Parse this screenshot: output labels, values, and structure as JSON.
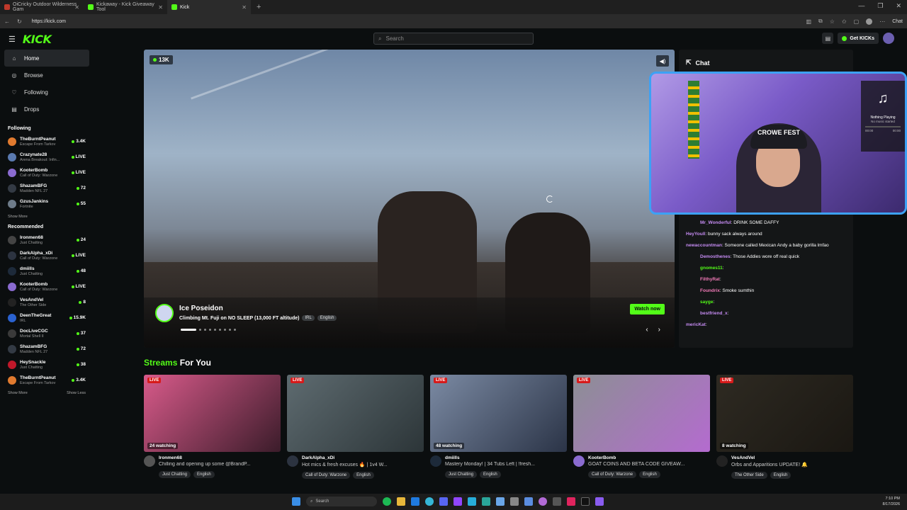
{
  "browser": {
    "tabs": [
      {
        "label": "OiCricky Outdoor Wilderness Gam",
        "color": "#c0392b"
      },
      {
        "label": "Kickaway - Kick Giveaway Tool",
        "color": "#53fc18"
      },
      {
        "label": "Kick",
        "color": "#53fc18"
      }
    ],
    "url": "https://kick.com",
    "chat_label": "Chat"
  },
  "header": {
    "logo": "KICK",
    "search_placeholder": "Search",
    "get_kicks": "Get KICKs"
  },
  "sidebar": {
    "nav": [
      {
        "label": "Home",
        "icon": "home-icon",
        "glyph": "⌂"
      },
      {
        "label": "Browse",
        "icon": "compass-icon",
        "glyph": "◎"
      },
      {
        "label": "Following",
        "icon": "heart-icon",
        "glyph": "♡"
      },
      {
        "label": "Drops",
        "icon": "drops-icon",
        "glyph": "▤"
      }
    ],
    "following_title": "Following",
    "following": [
      {
        "name": "TheBurntPeanut",
        "cat": "Escape From Tarkov",
        "count": "3.4K",
        "color": "#e07a2f"
      },
      {
        "name": "Crazynate28",
        "cat": "Arena Breakout: Infin...",
        "count": "LIVE",
        "color": "#5a7ab0"
      },
      {
        "name": "KooterBomb",
        "cat": "Call of Duty: Warzone",
        "count": "LIVE",
        "color": "#8a6bd0"
      },
      {
        "name": "ShazamBFG",
        "cat": "Madden NFL 27",
        "count": "72",
        "color": "#333a44"
      },
      {
        "name": "GzusJankins",
        "cat": "Fortnite",
        "count": "55",
        "color": "#6e7c8a"
      }
    ],
    "show_more": "Show More",
    "recommended_title": "Recommended",
    "recommended": [
      {
        "name": "Ironmen68",
        "cat": "Just Chatting",
        "count": "24",
        "color": "#444"
      },
      {
        "name": "DarkAlpha_xDi",
        "cat": "Call of Duty: Warzone",
        "count": "LIVE",
        "color": "#2c3340"
      },
      {
        "name": "dmiills",
        "cat": "Just Chatting",
        "count": "48",
        "color": "#1d2a3a"
      },
      {
        "name": "KooterBomb",
        "cat": "Call of Duty: Warzone",
        "count": "LIVE",
        "color": "#8a6bd0"
      },
      {
        "name": "VesAndVel",
        "cat": "The Other Side",
        "count": "8",
        "color": "#222"
      },
      {
        "name": "DeenTheGreat",
        "cat": "IRL",
        "count": "15.9K",
        "color": "#2a62d0"
      },
      {
        "name": "DocLiveCGC",
        "cat": "Mortal Shell II",
        "count": "37",
        "color": "#3a3a3a"
      },
      {
        "name": "ShazamBFG",
        "cat": "Madden NFL 27",
        "count": "72",
        "color": "#333a44"
      },
      {
        "name": "HeySnackle",
        "cat": "Just Chatting",
        "count": "38",
        "color": "#c0182a"
      },
      {
        "name": "TheBurntPeanut",
        "cat": "Escape From Tarkov",
        "count": "3.4K",
        "color": "#e07a2f"
      }
    ],
    "show_more_2": "Show More",
    "show_less": "Show Less"
  },
  "featured": {
    "viewers": "13K",
    "streamer": "Ice Poseidon",
    "title": "Climbing Mt. Fuji on NO SLEEP (13,000 FT altitude)",
    "tags": [
      "IRL",
      "English"
    ],
    "watch_now": "Watch now"
  },
  "chat": {
    "title": "Chat",
    "messages": [
      {
        "user": "Mr_Wonderful",
        "text": ": DRINK SOME DAFFY",
        "color": "#c58bf2",
        "indent": true
      },
      {
        "user": "HeyYoull",
        "text": ": bunny sack always around",
        "color": "#c58bf2",
        "indent": false
      },
      {
        "user": "newaccountman",
        "text": ": Someone called Mexican Andy a baby gorilla lmfao",
        "color": "#c58bf2",
        "indent": false
      },
      {
        "user": "Demosthenes",
        "text": ": Those Addies wore off real quick",
        "color": "#c58bf2",
        "indent": true
      },
      {
        "user": "gnomes11",
        "text": ":",
        "color": "#53fc18",
        "indent": true
      },
      {
        "user": "FilthyRat",
        "text": ":",
        "color": "#f27ab8",
        "indent": true
      },
      {
        "user": "Foundrix",
        "text": ": Smoke sumthin",
        "color": "#f27ab8",
        "indent": true
      },
      {
        "user": "sayge",
        "text": ":",
        "color": "#53fc18",
        "indent": true
      },
      {
        "user": "bestfriend_x",
        "text": ":",
        "color": "#c58bf2",
        "indent": true
      },
      {
        "user": "mericKat",
        "text": ":",
        "color": "#c58bf2",
        "indent": false
      }
    ]
  },
  "webcam": {
    "cap_text": "CROWE FEST",
    "music_status": "Nothing Playing",
    "music_sub": "No music started",
    "time_start": "00:00",
    "time_end": "00:00"
  },
  "streams_for_you": {
    "title_a": "Streams",
    "title_b": "For You",
    "live_label": "LIVE",
    "cards": [
      {
        "watching": "24 watching",
        "name": "Ironmen68",
        "title": "Chilling and opening up some @BrandP...",
        "tags": [
          "Just Chatting",
          "English"
        ],
        "bg": "linear-gradient(135deg,#d85a8a,#3b1c2a)",
        "av": "#555"
      },
      {
        "watching": "",
        "name": "DarkAlpha_xDi",
        "title": "Hot mics & fresh excuses 🔥 | 1v4 W...",
        "tags": [
          "Call of Duty: Warzone",
          "English"
        ],
        "bg": "linear-gradient(135deg,#5e6b70,#2c3538)",
        "av": "#2c3340"
      },
      {
        "watching": "48 watching",
        "name": "dmiills",
        "title": "Mastery Monday! | 34 Tubs Left | !fresh...",
        "tags": [
          "Just Chatting",
          "English"
        ],
        "bg": "linear-gradient(135deg,#7b8aa3,#2b3447)",
        "av": "#1d2a3a"
      },
      {
        "watching": "",
        "name": "KooterBomb",
        "title": "GOAT COINS AND BETA CODE GIVEAW...",
        "tags": [
          "Call of Duty: Warzone",
          "English"
        ],
        "bg": "linear-gradient(135deg,#8c8f94,#b46bcf)",
        "av": "#8a6bd0"
      },
      {
        "watching": "8 watching",
        "name": "VesAndVel",
        "title": "Orbs and Apparitions UPDATE! 🔔",
        "tags": [
          "The Other Side",
          "English"
        ],
        "bg": "linear-gradient(135deg,#2e2a22,#1a1712)",
        "av": "#222"
      }
    ]
  },
  "taskbar": {
    "search": "Search",
    "time": "7:10 PM",
    "date": "8/17/2026"
  }
}
